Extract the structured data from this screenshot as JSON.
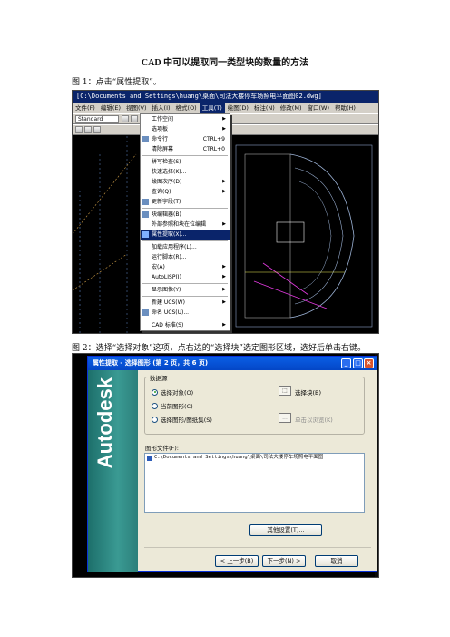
{
  "doc": {
    "title": "CAD 中可以提取同一类型块的数量的方法",
    "caption1": "图 1：点击“属性提取”。",
    "caption2": "图 2：选择“选择对象”这项，点右边的“选择块”选定图形区域，选好后单击右键。"
  },
  "shot1": {
    "window_title": "[C:\\Documents and Settings\\huang\\桌面\\司法大楼停车场照电平面图02.dwg]",
    "menus": [
      "文件(F)",
      "编辑(E)",
      "视图(V)",
      "插入(I)",
      "格式(O)",
      "工具(T)",
      "绘图(D)",
      "标注(N)",
      "修改(M)",
      "窗口(W)",
      "帮助(H)"
    ],
    "active_menu_index": 5,
    "style_combo": "Standard",
    "layer_combo": "ByLayer",
    "menu_items": [
      {
        "label": "工作空间",
        "arrow": true
      },
      {
        "label": "选项板",
        "arrow": true
      },
      {
        "label": "命令行",
        "shortcut": "CTRL+9",
        "icon": "command-line-icon"
      },
      {
        "label": "清除屏幕",
        "shortcut": "CTRL+0"
      },
      {
        "sep": true
      },
      {
        "label": "拼写检查(S)"
      },
      {
        "label": "快速选择(K)..."
      },
      {
        "label": "绘图次序(D)",
        "arrow": true
      },
      {
        "label": "查询(Q)",
        "arrow": true
      },
      {
        "label": "更新字段(T)",
        "icon": "update-field-icon"
      },
      {
        "sep": true
      },
      {
        "label": "块编辑器(B)",
        "icon": "block-editor-icon"
      },
      {
        "label": "外部参照和块在位编辑",
        "arrow": true
      },
      {
        "label": "属性提取(X)...",
        "highlight": true,
        "icon": "attribute-extract-icon"
      },
      {
        "sep": true
      },
      {
        "label": "加载应用程序(L)..."
      },
      {
        "label": "运行脚本(R)..."
      },
      {
        "label": "宏(A)",
        "arrow": true
      },
      {
        "label": "AutoLISP(I)",
        "arrow": true
      },
      {
        "sep": true
      },
      {
        "label": "显示图像(Y)",
        "arrow": true
      },
      {
        "sep": true
      },
      {
        "label": "新建 UCS(W)",
        "arrow": true
      },
      {
        "label": "命名 UCS(U)...",
        "icon": "ucs-icon"
      },
      {
        "sep": true
      },
      {
        "label": "CAD 标准(S)",
        "arrow": true
      }
    ]
  },
  "shot2": {
    "dialog_title": "属性提取 - 选择图形 (第 2 页，共 6 页)",
    "brand": "Autodesk",
    "group_label": "数据源",
    "radios": [
      {
        "label": "选择对象(O)",
        "checked": true
      },
      {
        "label": "当前图形(C)",
        "checked": false
      },
      {
        "label": "选择图形/图纸集(S)",
        "checked": false
      }
    ],
    "select_blocks_label": "选择块(B)",
    "browse_label": "单击以浏览(K)",
    "files_label": "图形文件(F):",
    "files": [
      "C:\\Documents and Settings\\huang\\桌面\\司法大楼停车场照电平面图"
    ],
    "other_settings_label": "其他设置(T)...",
    "back_label": "< 上一步(B)",
    "next_label": "下一步(N) >",
    "cancel_label": "取消"
  },
  "colors": {
    "title_bar": "#0a246a",
    "xp_title": "#0a5fe5",
    "brand_panel": "#2c7f7a",
    "menu_highlight": "#0a246a"
  }
}
